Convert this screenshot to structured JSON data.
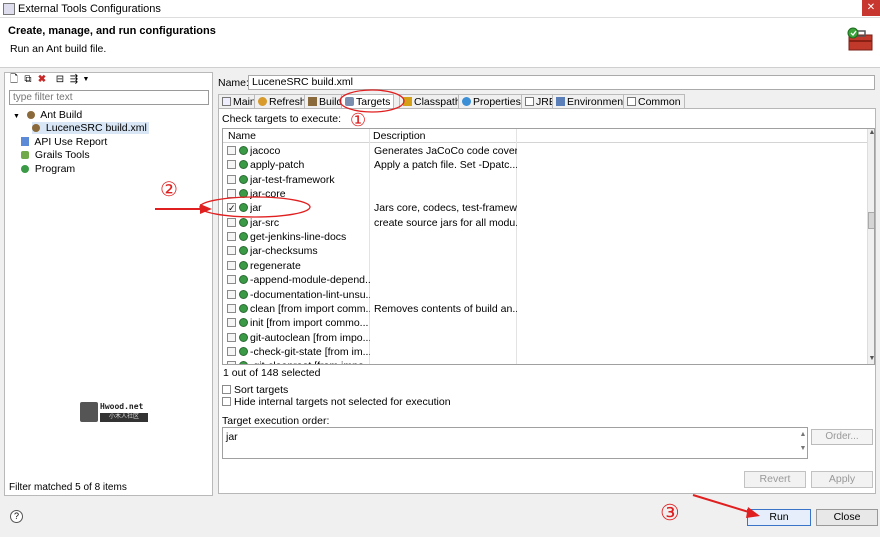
{
  "window": {
    "title": "External Tools Configurations",
    "close_symbol": "✕"
  },
  "header": {
    "title": "Create, manage, and run configurations",
    "subtitle": "Run an Ant build file."
  },
  "left": {
    "filter_placeholder": "type filter text",
    "tree": [
      {
        "label": "Ant Build",
        "expander": "▼",
        "icon": "ant-icon"
      },
      {
        "label": "LuceneSRC build.xml",
        "icon": "ant-file-icon",
        "selected": true
      },
      {
        "label": "API Use Report",
        "icon": "report-icon"
      },
      {
        "label": "Grails Tools",
        "icon": "grails-icon"
      },
      {
        "label": "Program",
        "icon": "program-icon"
      }
    ],
    "status": "Filter matched 5 of 8 items"
  },
  "right": {
    "name_label": "Name:",
    "name_value": "LuceneSRC build.xml",
    "tabs": [
      {
        "label": "Main",
        "icon": "main-icon"
      },
      {
        "label": "Refresh",
        "icon": "refresh-icon"
      },
      {
        "label": "Build",
        "icon": "build-icon"
      },
      {
        "label": "Targets",
        "icon": "targets-icon",
        "active": true
      },
      {
        "label": "Classpath",
        "icon": "classpath-icon"
      },
      {
        "label": "Properties",
        "icon": "properties-icon"
      },
      {
        "label": "JRE",
        "icon": "jre-icon"
      },
      {
        "label": "Environment",
        "icon": "environment-icon"
      },
      {
        "label": "Common",
        "icon": "common-icon"
      }
    ],
    "check_label": "Check targets to execute:",
    "table_headers": {
      "name": "Name",
      "description": "Description"
    },
    "targets": [
      {
        "name": "jacoco",
        "description": "Generates JaCoCo code cover...",
        "checked": false
      },
      {
        "name": "apply-patch",
        "description": "Apply a patch file.  Set -Dpatc...",
        "checked": false
      },
      {
        "name": "jar-test-framework",
        "description": "",
        "checked": false
      },
      {
        "name": "jar-core",
        "description": "",
        "checked": false
      },
      {
        "name": "jar",
        "description": "Jars core, codecs, test-framew...",
        "checked": true
      },
      {
        "name": "jar-src",
        "description": "create source jars for all modu...",
        "checked": false
      },
      {
        "name": "get-jenkins-line-docs",
        "description": "",
        "checked": false
      },
      {
        "name": "jar-checksums",
        "description": "",
        "checked": false
      },
      {
        "name": "regenerate",
        "description": "",
        "checked": false
      },
      {
        "name": "-append-module-depend...",
        "description": "",
        "checked": false
      },
      {
        "name": "-documentation-lint-unsu...",
        "description": "",
        "checked": false
      },
      {
        "name": "clean [from import comm...",
        "description": "Removes contents of build an...",
        "checked": false
      },
      {
        "name": "init [from import commo...",
        "description": "",
        "checked": false
      },
      {
        "name": "git-autoclean [from impo...",
        "description": "",
        "checked": false
      },
      {
        "name": "-check-git-state [from im...",
        "description": "",
        "checked": false
      },
      {
        "name": "-git-cleanroot [from impo...",
        "description": "",
        "checked": false
      }
    ],
    "selection_count": "1 out of 148 selected",
    "sort_targets": "Sort targets",
    "hide_internal": "Hide internal targets not selected for execution",
    "order_label": "Target execution order:",
    "order_value": "jar",
    "order_button": "Order...",
    "revert_button": "Revert",
    "apply_button": "Apply"
  },
  "footer": {
    "help_symbol": "?",
    "run_button": "Run",
    "close_button": "Close"
  },
  "watermark": {
    "brand": "Hwood.net",
    "tagline": "小木人社区"
  },
  "annotations": {
    "marks": [
      "①",
      "②",
      "③"
    ],
    "color": "#e02020"
  }
}
